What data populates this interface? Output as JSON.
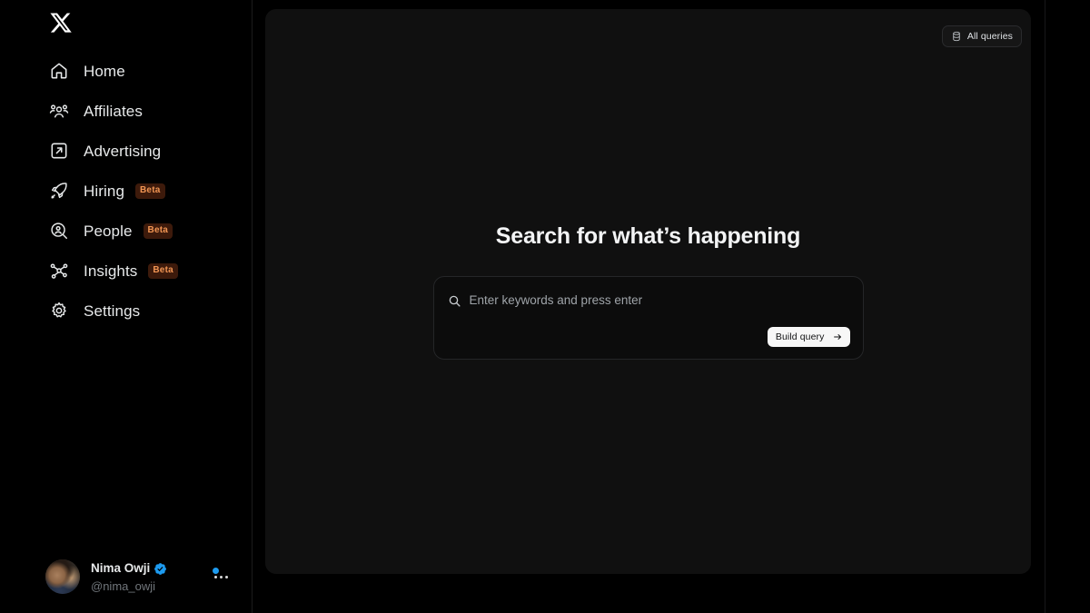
{
  "brand": {
    "logo_icon": "x-logo-icon"
  },
  "sidebar": {
    "items": [
      {
        "label": "Home",
        "icon": "home-icon",
        "badge": null
      },
      {
        "label": "Affiliates",
        "icon": "users-group-icon",
        "badge": null
      },
      {
        "label": "Advertising",
        "icon": "external-link-box-icon",
        "badge": null
      },
      {
        "label": "Hiring",
        "icon": "rocket-icon",
        "badge": "Beta"
      },
      {
        "label": "People",
        "icon": "person-search-icon",
        "badge": "Beta"
      },
      {
        "label": "Insights",
        "icon": "network-graph-icon",
        "badge": "Beta"
      },
      {
        "label": "Settings",
        "icon": "gear-icon",
        "badge": null
      }
    ],
    "account": {
      "display_name": "Nima Owji",
      "handle": "@nima_owji",
      "verified": true,
      "verified_icon": "verified-badge-icon",
      "more_icon": "more-horizontal-icon",
      "has_notification_dot": true,
      "avatar_icon": "user-avatar"
    }
  },
  "main": {
    "all_queries": {
      "label": "All queries",
      "icon": "database-icon"
    },
    "hero_title": "Search for what’s happening",
    "search": {
      "icon": "search-icon",
      "value": "",
      "placeholder": "Enter keywords and press enter"
    },
    "build_query": {
      "label": "Build query",
      "icon": "arrow-right-icon"
    }
  },
  "colors": {
    "page_background": "#000000",
    "panel_background": "#101010",
    "accent_blue": "#1d9bf0",
    "badge_background": "#3d1a0b",
    "badge_text": "#f19553",
    "primary_text": "#e7e9ea",
    "muted_text": "#71767b",
    "button_light": "#f7f7f7"
  }
}
